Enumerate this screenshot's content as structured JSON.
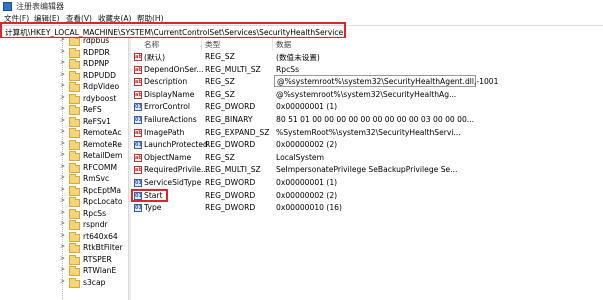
{
  "window": {
    "title": "注册表编辑器",
    "icon": "registry-editor-icon"
  },
  "menu": [
    "文件(F)",
    "编辑(E)",
    "查看(V)",
    "收藏夹(A)",
    "帮助(H)"
  ],
  "address": {
    "path": "计算机\\HKEY_LOCAL_MACHINE\\SYSTEM\\CurrentControlSet\\Services\\SecurityHealthService",
    "highlight_color": "#d9272e"
  },
  "tree": {
    "items": [
      "rdpbus",
      "RDPDR",
      "RDPNP",
      "RDPUDD",
      "RdpVideo",
      "rdyboost",
      "ReFS",
      "ReFSv1",
      "RemoteAc",
      "RemoteRe",
      "RetailDem",
      "RFCOMM",
      "RmSvc",
      "RpcEptMa",
      "RpcLocato",
      "RpcSs",
      "rspndr",
      "rt640x64",
      "RtkBtFilter",
      "RTSPER",
      "RTWlanE",
      "s3cap"
    ]
  },
  "list": {
    "headers": {
      "name": "名称",
      "type": "类型",
      "data": "数据"
    },
    "rows": [
      {
        "icon": "string-value-icon",
        "name": "(默认)",
        "type": "REG_SZ",
        "data": "(数值未设置)"
      },
      {
        "icon": "string-value-icon",
        "name": "DependOnSer...",
        "type": "REG_MULTI_SZ",
        "data": "RpcSs"
      },
      {
        "icon": "string-value-icon",
        "name": "Description",
        "type": "REG_SZ",
        "data": "@%systemroot%\\system32\\SecurityHealthAgent.dll,-1001"
      },
      {
        "icon": "string-value-icon",
        "name": "DisplayName",
        "type": "REG_SZ",
        "data": "@%systemroot%\\system32\\SecurityHealthAg..."
      },
      {
        "icon": "binary-value-icon",
        "name": "ErrorControl",
        "type": "REG_DWORD",
        "data": "0x00000001 (1)"
      },
      {
        "icon": "binary-value-icon",
        "name": "FailureActions",
        "type": "REG_BINARY",
        "data": "80 51 01 00 00 00 00 00 00 00 00 00 03 00 00 00..."
      },
      {
        "icon": "string-value-icon",
        "name": "ImagePath",
        "type": "REG_EXPAND_SZ",
        "data": "%SystemRoot%\\system32\\SecurityHealthServi..."
      },
      {
        "icon": "binary-value-icon",
        "name": "LaunchProtected",
        "type": "REG_DWORD",
        "data": "0x00000002 (2)"
      },
      {
        "icon": "string-value-icon",
        "name": "ObjectName",
        "type": "REG_SZ",
        "data": "LocalSystem"
      },
      {
        "icon": "string-value-icon",
        "name": "RequiredPrivile...",
        "type": "REG_MULTI_SZ",
        "data": "SeImpersonatePrivilege SeBackupPrivilege Se..."
      },
      {
        "icon": "binary-value-icon",
        "name": "ServiceSidType",
        "type": "REG_DWORD",
        "data": "0x00000001 (1)"
      },
      {
        "icon": "binary-value-icon",
        "name": "Start",
        "type": "REG_DWORD",
        "data": "0x00000002 (2)"
      },
      {
        "icon": "binary-value-icon",
        "name": "Type",
        "type": "REG_DWORD",
        "data": "0x00000010 (16)"
      }
    ]
  }
}
